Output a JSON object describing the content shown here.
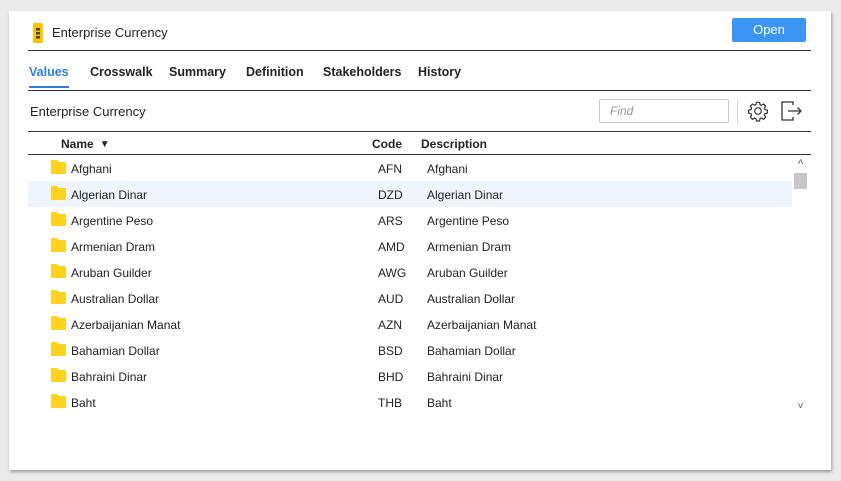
{
  "window": {
    "title": "Enterprise Currency",
    "open_label": "Open",
    "accent_color": "#3b95f5"
  },
  "tabs": [
    {
      "label": "Values",
      "active": true
    },
    {
      "label": "Crosswalk",
      "active": false
    },
    {
      "label": "Summary",
      "active": false
    },
    {
      "label": "Definition",
      "active": false
    },
    {
      "label": "Stakeholders",
      "active": false
    },
    {
      "label": "History",
      "active": false
    }
  ],
  "section": {
    "title": "Enterprise Currency",
    "find_placeholder": "Find",
    "find_value": "",
    "icons": [
      "gear-icon",
      "export-icon"
    ]
  },
  "table": {
    "columns": {
      "name": "Name",
      "code": "Code",
      "description": "Description"
    },
    "sort": {
      "column": "Name",
      "direction": "descending-arrow"
    },
    "rows": [
      {
        "name": "Afghani",
        "code": "AFN",
        "description": "Afghani",
        "highlighted": false
      },
      {
        "name": "Algerian Dinar",
        "code": "DZD",
        "description": "Algerian Dinar",
        "highlighted": true
      },
      {
        "name": "Argentine Peso",
        "code": "ARS",
        "description": "Argentine Peso",
        "highlighted": false
      },
      {
        "name": "Armenian Dram",
        "code": "AMD",
        "description": "Armenian Dram",
        "highlighted": false
      },
      {
        "name": "Aruban Guilder",
        "code": "AWG",
        "description": "Aruban Guilder",
        "highlighted": false
      },
      {
        "name": "Australian Dollar",
        "code": "AUD",
        "description": "Australian Dollar",
        "highlighted": false
      },
      {
        "name": "Azerbaijanian Manat",
        "code": "AZN",
        "description": "Azerbaijanian Manat",
        "highlighted": false
      },
      {
        "name": "Bahamian Dollar",
        "code": "BSD",
        "description": "Bahamian Dollar",
        "highlighted": false
      },
      {
        "name": "Bahraini Dinar",
        "code": "BHD",
        "description": "Bahraini Dinar",
        "highlighted": false
      },
      {
        "name": "Baht",
        "code": "THB",
        "description": "Baht",
        "highlighted": false
      }
    ],
    "folder_color": "#ffd21f",
    "highlight_color": "#eef5fc"
  }
}
